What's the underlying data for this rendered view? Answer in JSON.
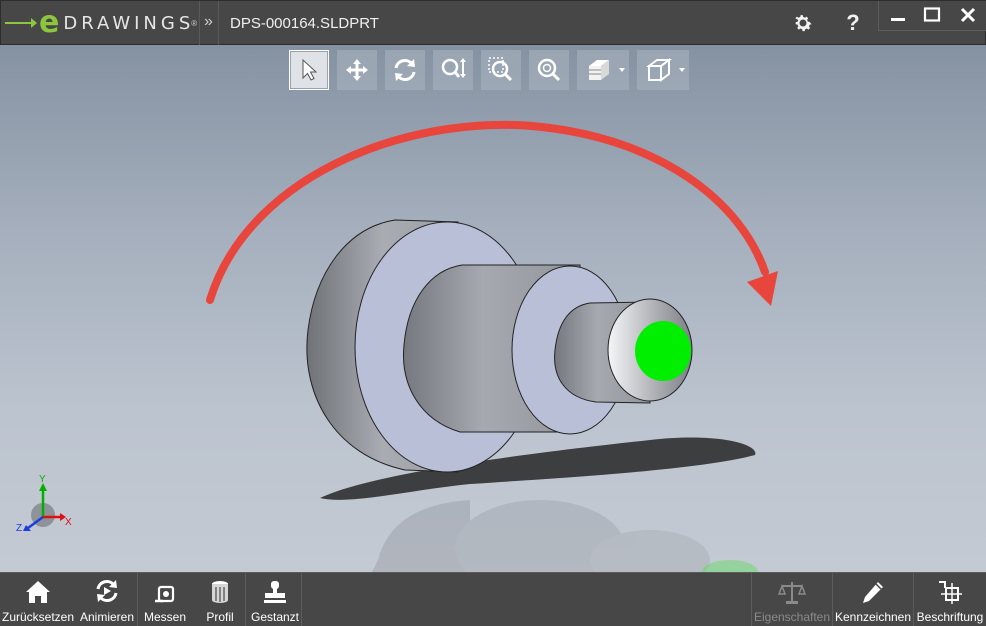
{
  "app": {
    "logo_e": "e",
    "logo_word": "DRAWINGS",
    "logo_reg": "®",
    "breadcrumb_chevron": "»",
    "filename": "DPS-000164.SLDPRT"
  },
  "titlebar_icons": [
    "gear-icon",
    "help-icon"
  ],
  "help_glyph": "?",
  "window_controls": [
    "minimize-icon",
    "maximize-icon",
    "close-icon"
  ],
  "view_toolbar": [
    {
      "name": "select-tool",
      "icon": "arrow-pointer-icon",
      "active": true
    },
    {
      "name": "pan-tool",
      "icon": "move-arrows-icon"
    },
    {
      "name": "rotate-tool",
      "icon": "rotate-icon"
    },
    {
      "name": "zoom-tool",
      "icon": "zoom-in-out-icon"
    },
    {
      "name": "zoom-area-tool",
      "icon": "zoom-area-icon"
    },
    {
      "name": "zoom-fit-tool",
      "icon": "zoom-fit-icon"
    },
    {
      "name": "display-style-menu",
      "icon": "shaded-box-icon",
      "dropdown": true
    },
    {
      "name": "view-orientation-menu",
      "icon": "cube-icon",
      "dropdown": true
    }
  ],
  "triad": {
    "x_label": "X",
    "y_label": "Y",
    "z_label": "Z"
  },
  "bottom_toolbar": {
    "reset": "Zurücksetzen",
    "animate": "Animieren",
    "measure": "Messen",
    "profile": "Profil",
    "stamped": "Gestanzt",
    "properties": "Eigenschaften",
    "markup": "Kennzeichnen",
    "annotate": "Beschriftung"
  },
  "colors": {
    "accent_green": "#8cc63f",
    "face_highlight": "#00ee00",
    "rotation_arrow": "#e8453c",
    "part_gray": "#a9acb2",
    "part_lavender": "#babfd8"
  }
}
